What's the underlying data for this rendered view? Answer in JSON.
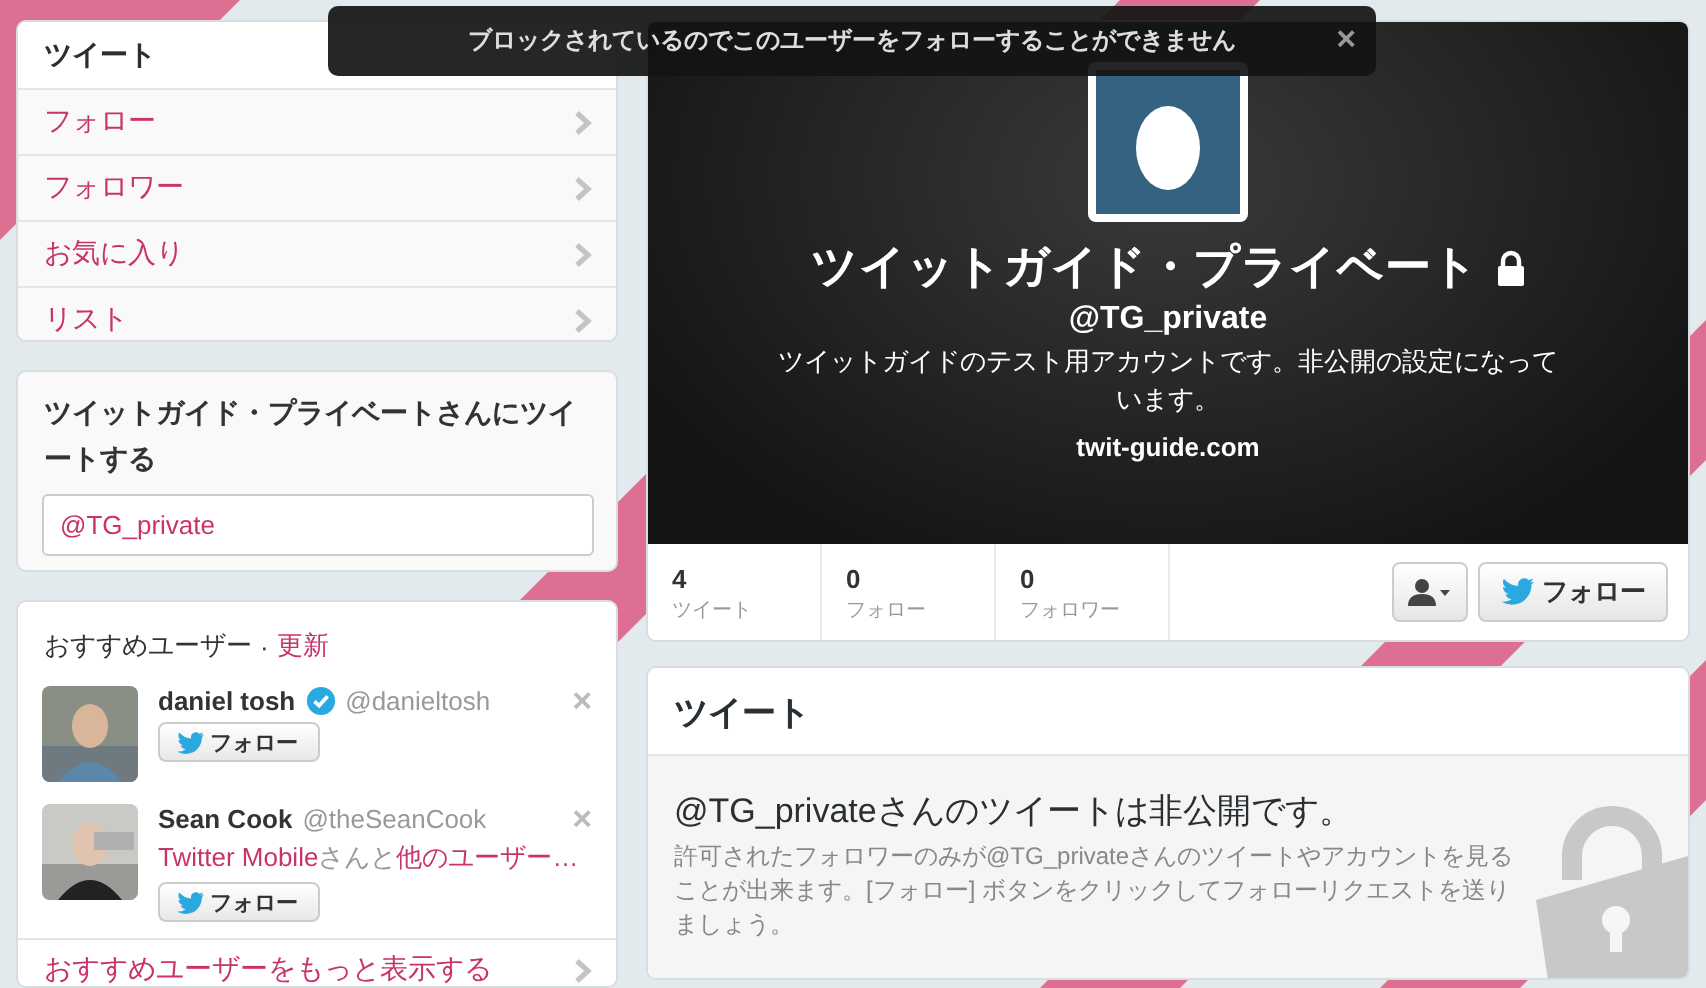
{
  "alert": {
    "message": "ブロックされているのでこのユーザーをフォローすることができません",
    "close": "×"
  },
  "nav": {
    "items": [
      {
        "label": "ツイート",
        "selected": true
      },
      {
        "label": "フォロー",
        "selected": false
      },
      {
        "label": "フォロワー",
        "selected": false
      },
      {
        "label": "お気に入り",
        "selected": false
      },
      {
        "label": "リスト",
        "selected": false
      }
    ]
  },
  "compose": {
    "title": "ツイットガイド・プライベートさんにツイートする",
    "value": "@TG_private"
  },
  "suggestions": {
    "title": "おすすめユーザー",
    "separator": "·",
    "refresh": "更新",
    "users": [
      {
        "name": "daniel tosh",
        "verified": true,
        "handle": "@danieltosh",
        "follow": "フォロー",
        "dismiss": "×"
      },
      {
        "name": "Sean Cook",
        "verified": false,
        "handle": "@theSeanCook",
        "context": [
          {
            "text": "Twitter Mobile",
            "kind": "link"
          },
          {
            "text": "さんと",
            "kind": "plain"
          },
          {
            "text": "他のユーザー…",
            "kind": "link"
          }
        ],
        "follow": "フォロー",
        "dismiss": "×"
      }
    ],
    "more": "おすすめユーザーをもっと表示する"
  },
  "profile": {
    "name": "ツイットガイド・プライベート",
    "protected": true,
    "handle": "@TG_private",
    "bio": "ツイットガイドのテスト用アカウントです。非公開の設定になっています。",
    "url": "twit-guide.com",
    "stats": [
      {
        "value": "4",
        "label": "ツイート"
      },
      {
        "value": "0",
        "label": "フォロー"
      },
      {
        "value": "0",
        "label": "フォロワー"
      }
    ],
    "follow": "フォロー"
  },
  "tweets": {
    "title": "ツイート",
    "heading": "@TG_privateさんのツイートは非公開です。",
    "description": "許可されたフォロワーのみが@TG_privateさんのツイートやアカウントを見ることが出来ます。[フォロー] ボタンをクリックしてフォローリクエストを送りましょう。"
  }
}
